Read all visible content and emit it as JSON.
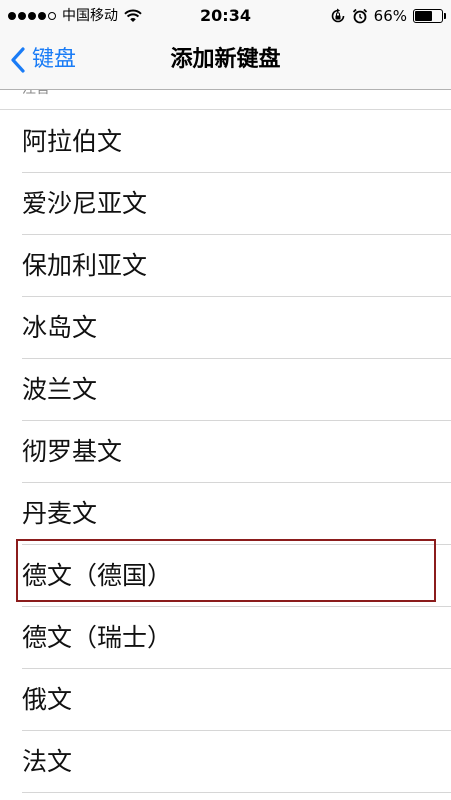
{
  "status_bar": {
    "carrier": "中国移动",
    "time": "20:34",
    "battery_percent": "66%",
    "battery_level": 0.66,
    "signal_dots_filled": 4,
    "signal_dots_total": 5,
    "icons": [
      "wifi-icon",
      "rotation-lock-icon",
      "alarm-icon",
      "battery-icon"
    ]
  },
  "nav": {
    "back_label": "键盘",
    "title": "添加新键盘",
    "accent_color": "#1a7cf6"
  },
  "list": {
    "partial_label": "注音",
    "items": [
      {
        "label": "阿拉伯文"
      },
      {
        "label": "爱沙尼亚文"
      },
      {
        "label": "保加利亚文"
      },
      {
        "label": "冰岛文"
      },
      {
        "label": "波兰文"
      },
      {
        "label": "彻罗基文"
      },
      {
        "label": "丹麦文"
      },
      {
        "label": "德文（德国）",
        "highlighted": true
      },
      {
        "label": "德文（瑞士）"
      },
      {
        "label": "俄文"
      },
      {
        "label": "法文"
      }
    ],
    "highlight_color": "#8b1c1c"
  }
}
